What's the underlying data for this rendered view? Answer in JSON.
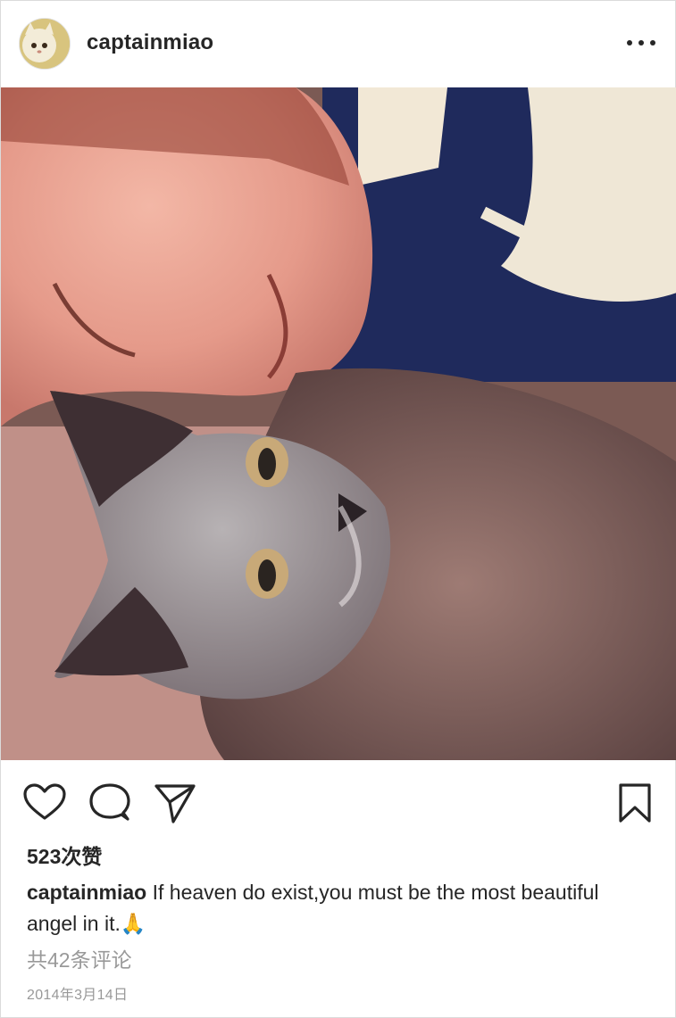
{
  "post": {
    "username": "captainmiao",
    "likes": "523次赞",
    "caption_user": "captainmiao",
    "caption_text": " If heaven do exist,you must be the most beautiful angel in it.",
    "caption_emoji": "🙏",
    "comments_link": "共42条评论",
    "date": "2014年3月14日"
  },
  "icons": {
    "more": "more-options-icon",
    "like": "heart-icon",
    "comment": "comment-bubble-icon",
    "share": "paper-plane-icon",
    "save": "bookmark-icon"
  },
  "colors": {
    "text": "#262626",
    "muted": "#999999",
    "border": "#dbdbdb"
  }
}
